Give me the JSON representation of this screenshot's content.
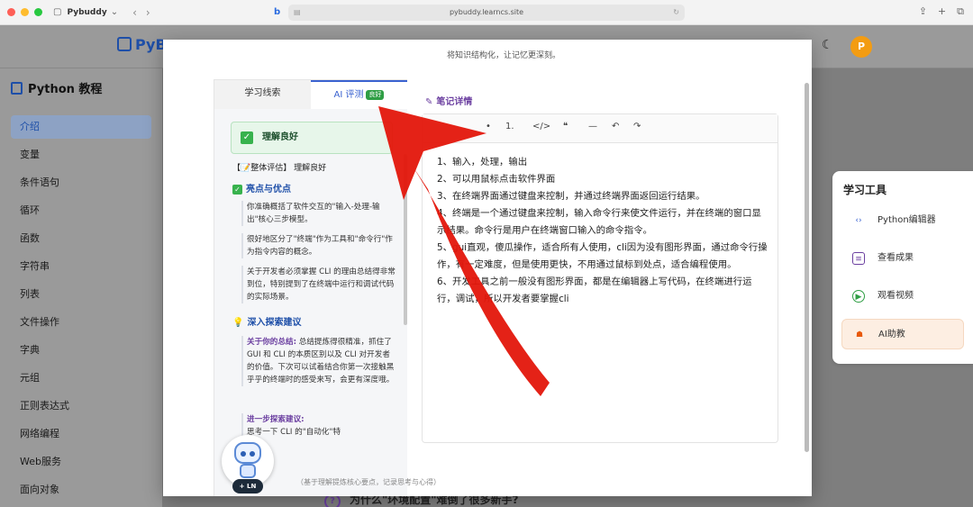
{
  "browser": {
    "profile_name": "Pybuddy",
    "url": "pybuddy.learncs.site"
  },
  "header": {
    "logo_text": "PyB",
    "avatar_letter": "P"
  },
  "sidebar": {
    "title": "Python 教程",
    "items": [
      {
        "label": "介绍",
        "active": true
      },
      {
        "label": "变量"
      },
      {
        "label": "条件语句"
      },
      {
        "label": "循环"
      },
      {
        "label": "函数"
      },
      {
        "label": "字符串"
      },
      {
        "label": "列表"
      },
      {
        "label": "文件操作"
      },
      {
        "label": "字典"
      },
      {
        "label": "元组"
      },
      {
        "label": "正则表达式"
      },
      {
        "label": "网络编程"
      },
      {
        "label": "Web服务"
      },
      {
        "label": "面向对象"
      }
    ]
  },
  "tools": {
    "title": "学习工具",
    "items": [
      {
        "label": "Python编辑器",
        "icon": "code-icon"
      },
      {
        "label": "查看成果",
        "icon": "document-icon"
      },
      {
        "label": "观看视频",
        "icon": "play-icon"
      },
      {
        "label": "AI助教",
        "icon": "robot-icon",
        "highlighted": true
      }
    ]
  },
  "bottom_question": "为什么\"环境配置\"难倒了很多新手?",
  "modal": {
    "subtitle": "将知识结构化，让记忆更深刻。",
    "tabs": [
      {
        "label": "学习线索"
      },
      {
        "label": "AI 评测",
        "badge": "良好",
        "active": true
      }
    ],
    "result_label": "理解良好",
    "overall": "【📝整体评估】 理解良好",
    "highlights_title": "亮点与优点",
    "highlights": [
      "你准确概括了软件交互的\"输入-处理-输出\"核心三步模型。",
      "很好地区分了\"终端\"作为工具和\"命令行\"作为指令内容的概念。",
      "关于开发者必须掌握 CLI 的理由总结得非常到位，特别提到了在终端中运行和调试代码的实际场景。"
    ],
    "explore_title": "深入探索建议",
    "explore_lead": "关于你的总结:",
    "explore_text": "总结提炼得很精准，抓住了 GUI 和 CLI 的本质区别以及 CLI 对开发者的价值。下次可以试着结合你第一次接触黑乎乎的终端时的感受来写，会更有深度哦。",
    "explore_more": "进一步探索建议:",
    "explore_more_text": "思考一下 CLI 的\"自动化\"特",
    "note_title": "笔记详情",
    "toolbar": [
      "•",
      "1.",
      "</>",
      "❝",
      "—",
      "↶",
      "↷"
    ],
    "note_lines": [
      "1、输入，处理，输出",
      "2、可以用鼠标点击软件界面",
      "3、在终端界面通过键盘来控制，并通过终端界面返回运行结果。",
      "4、终端是一个通过键盘来控制，输入命令行来使文件运行，并在终端的窗口显示结果。命令行是用户在终端窗口输入的命令指令。",
      "5、gui直观，傻瓜操作，适合所有人使用，cli因为没有图形界面，通过命令行操作，有一定难度，但是使用更快，不用通过鼠标到处点，适合编程使用。",
      "6、开发工具之前一般没有图形界面，都是在编辑器上写代码，在终端进行运行，调试，所以开发者要掌握cli"
    ],
    "hint": "（基于理解提炼核心要点，记录思考与心得）"
  },
  "assistant_badge": "LN",
  "colors": {
    "accent": "#3a62d0",
    "success": "#37b24d",
    "annotation_arrow": "#e3160b",
    "avatar": "#f39c12"
  }
}
